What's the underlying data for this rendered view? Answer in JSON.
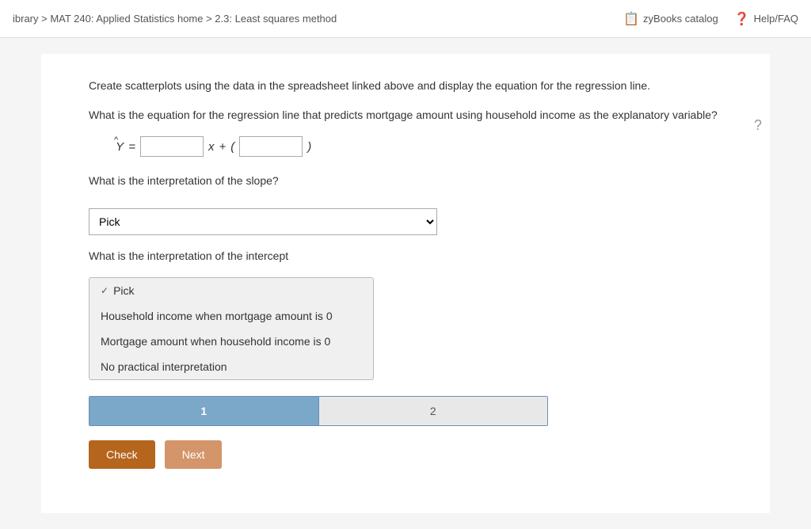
{
  "topbar": {
    "breadcrumb": "ibrary > MAT 240: Applied Statistics home > 2.3: Least squares method",
    "catalog_label": "zyBooks catalog",
    "help_label": "Help/FAQ"
  },
  "content": {
    "instruction_text": "Create scatterplots using the data in the spreadsheet linked above and display the equation for the regression line.",
    "question1_text": "What is the equation for the regression line that predicts mortgage amount using household income as the explanatory variable?",
    "equation": {
      "y_hat": "Ŷ",
      "equals": "=",
      "x_label": "x",
      "plus": "+",
      "open_paren": "(",
      "close_paren": ")",
      "input1_placeholder": "",
      "input2_placeholder": ""
    },
    "question2_text": "What is the interpretation of the slope?",
    "slope_dropdown": {
      "selected": "Pick",
      "options": [
        "Pick",
        "Household income when mortgage amount is 0",
        "Mortgage amount when household income is 0",
        "No practical interpretation"
      ]
    },
    "question3_text": "What is the interpretation of the intercept",
    "intercept_dropdown": {
      "check_item": "Pick",
      "items": [
        "Household income when mortgage amount is 0",
        "Mortgage amount when household income is 0",
        "No practical interpretation"
      ]
    },
    "progress": {
      "segment1_label": "1",
      "segment2_label": "2"
    },
    "buttons": {
      "check_label": "Check",
      "next_label": "Next"
    }
  }
}
